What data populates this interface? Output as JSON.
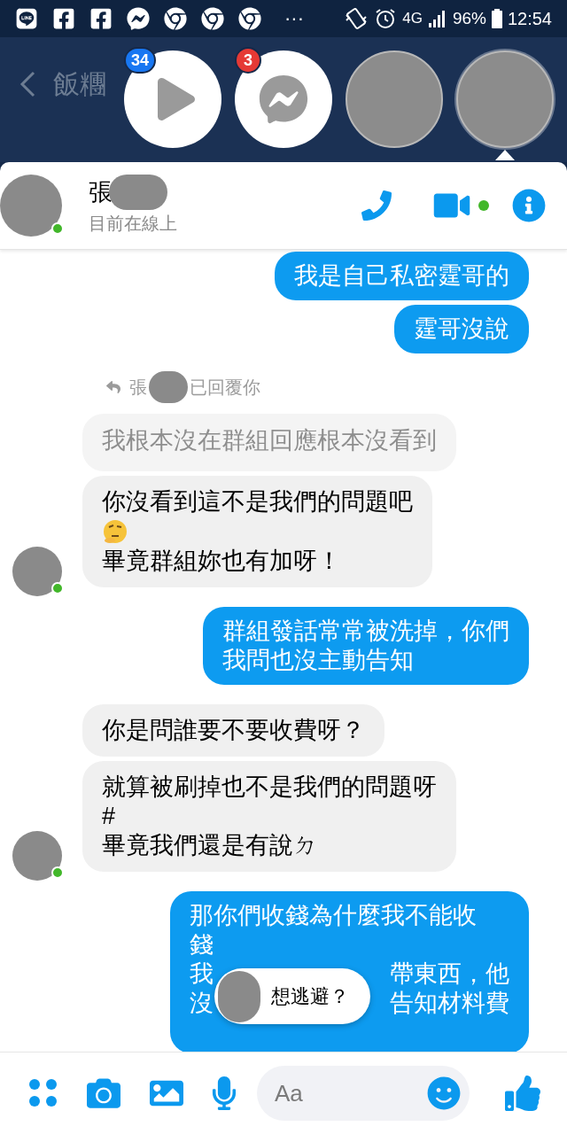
{
  "status_bar": {
    "app_icons": [
      {
        "kind": "line"
      },
      {
        "kind": "facebook"
      },
      {
        "kind": "facebook"
      },
      {
        "kind": "messenger"
      },
      {
        "kind": "chrome"
      },
      {
        "kind": "chrome"
      },
      {
        "kind": "chrome"
      }
    ],
    "more": "···",
    "network": "4G",
    "battery": "96%",
    "time": "12:54"
  },
  "background_chat": {
    "title": "飯糰"
  },
  "chat_heads": [
    {
      "kind": "play",
      "badge": "34",
      "selected": false
    },
    {
      "kind": "messenger",
      "badge": "3",
      "selected": false
    },
    {
      "kind": "avatar",
      "selected": false
    },
    {
      "kind": "avatar",
      "selected": true
    }
  ],
  "conversation": {
    "name": "張",
    "status": "目前在線上",
    "online": true,
    "video_active": true
  },
  "messages": [
    {
      "kind": "outgoing",
      "lines": [
        {
          "kind": "text",
          "text": "我是自己私密霆哥的"
        }
      ]
    },
    {
      "kind": "outgoing",
      "lines": [
        {
          "kind": "text",
          "text": "霆哥沒說"
        }
      ]
    },
    {
      "kind": "reply_note",
      "before": "張",
      "after": "已回覆你"
    },
    {
      "kind": "quoted",
      "lines": [
        {
          "kind": "text",
          "text": "我根本沒在群組回應根本沒看到"
        }
      ]
    },
    {
      "kind": "incoming",
      "avatar": true,
      "lines": [
        {
          "kind": "text",
          "text": "你沒看到這不是我們的問題吧"
        },
        {
          "kind": "emoji"
        },
        {
          "kind": "text",
          "text": "畢竟群組妳也有加呀！"
        }
      ]
    },
    {
      "kind": "outgoing",
      "lines": [
        {
          "kind": "text",
          "text": "群組發話常常被洗掉，你們"
        },
        {
          "kind": "text",
          "text": "我問也沒主動告知"
        }
      ]
    },
    {
      "kind": "incoming",
      "avatar": false,
      "lines": [
        {
          "kind": "text",
          "text": "你是問誰要不要收費呀？"
        }
      ]
    },
    {
      "kind": "incoming",
      "avatar": true,
      "lines": [
        {
          "kind": "text",
          "text": "就算被刷掉也不是我們的問題呀"
        },
        {
          "kind": "text",
          "text": "#"
        },
        {
          "kind": "text",
          "text": "畢竟我們還是有說ㄉ"
        }
      ]
    },
    {
      "kind": "outgoing",
      "lines": [
        {
          "kind": "text",
          "text": "那你們收錢為什麼我不能收"
        },
        {
          "kind": "text",
          "text": "錢"
        },
        {
          "kind": "split",
          "left": "我",
          "right": "帶東西，他"
        },
        {
          "kind": "split",
          "left": "沒",
          "right": "告知材料費"
        }
      ],
      "overlay": {
        "text": "想逃避？"
      }
    }
  ],
  "composer": {
    "placeholder": "Aa"
  }
}
